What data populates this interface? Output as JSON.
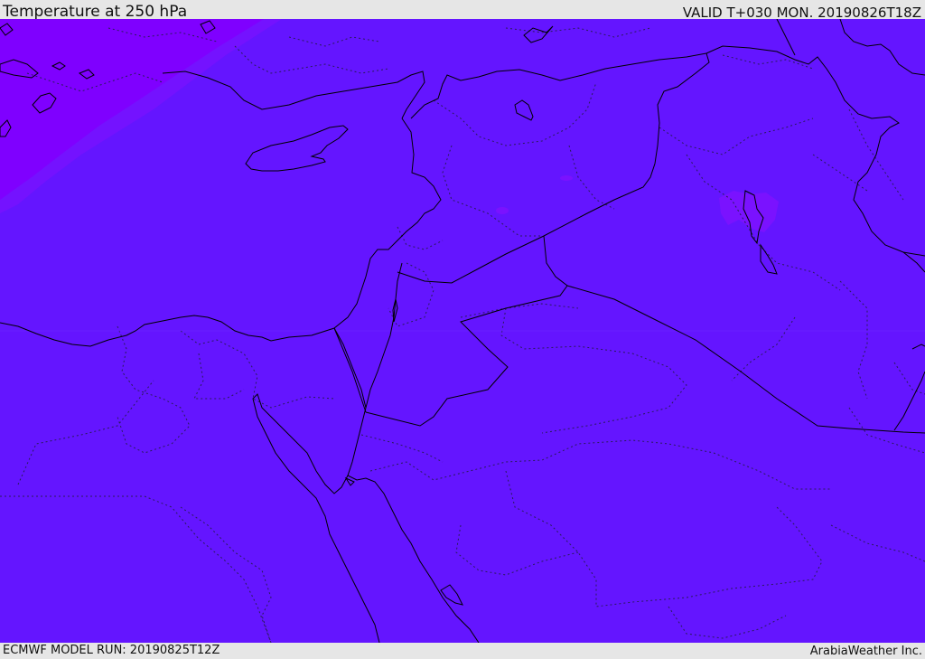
{
  "header": {
    "title": "Temperature at 250 hPa",
    "valid_time": "VALID T+030 MON. 20190826T18Z"
  },
  "footer": {
    "model_run": "ECMWF MODEL RUN: 20190825T12Z",
    "credit": "ArabiaWeather Inc."
  },
  "map": {
    "colors": {
      "main_field": "#6415ff",
      "cold_field_northwest": "#7f00ff",
      "transition_band": "#7412ff",
      "small_patch": "#7a12ff",
      "coastline": "#000000",
      "border_dotted": "#2a1a5a"
    }
  }
}
